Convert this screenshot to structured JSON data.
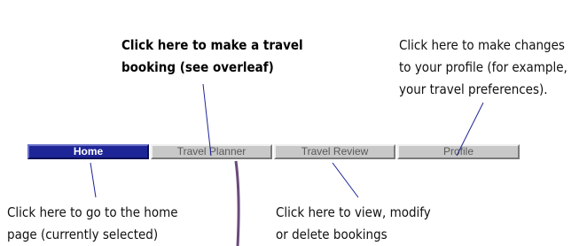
{
  "nav": {
    "tabs": [
      {
        "label": "Home",
        "selected": true
      },
      {
        "label": "Travel Planner",
        "selected": false
      },
      {
        "label": "Travel Review",
        "selected": false
      },
      {
        "label": "Profile",
        "selected": false
      }
    ]
  },
  "callouts": {
    "booking": {
      "lines": [
        "Click here to make a travel",
        "booking (see overleaf)"
      ]
    },
    "profile": {
      "lines": [
        "Click here to make changes",
        "to your profile (for example,",
        "your travel preferences)."
      ]
    },
    "home": {
      "lines": [
        "Click here to go to the home",
        "page (currently selected)"
      ]
    },
    "review": {
      "lines": [
        "Click here to view, modify",
        "or delete bookings"
      ]
    }
  },
  "colors": {
    "selected_tab": "#1e2596",
    "unselected_tab": "#c8c8c8",
    "pointer_line": "#1e2596",
    "curve_line": "#6b4a7a"
  }
}
